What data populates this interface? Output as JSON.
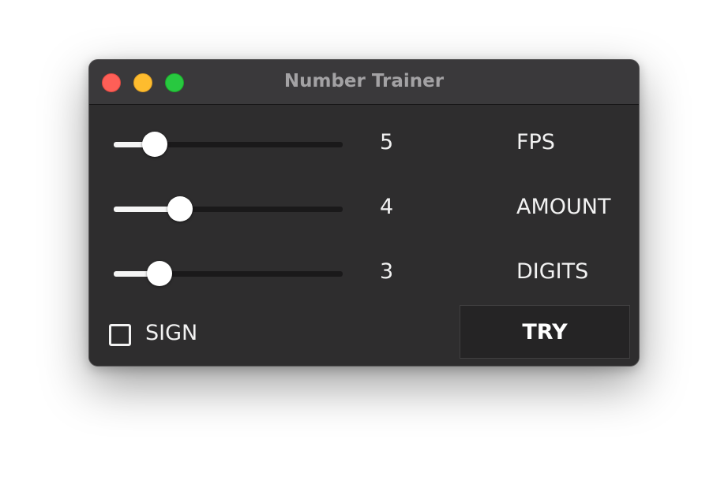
{
  "window": {
    "title": "Number Trainer"
  },
  "sliders": [
    {
      "value": "5",
      "label": "FPS",
      "level": 0.18
    },
    {
      "value": "4",
      "label": "AMOUNT",
      "level": 0.29
    },
    {
      "value": "3",
      "label": "DIGITS",
      "level": 0.2
    }
  ],
  "sign": {
    "label": "SIGN",
    "checked": false
  },
  "try_button": {
    "label": "TRY"
  },
  "colors": {
    "close": "#fe5f57",
    "minimize": "#febc2e",
    "zoom": "#28c840",
    "background": "#2e2d2e",
    "text": "#f2f2f2"
  }
}
